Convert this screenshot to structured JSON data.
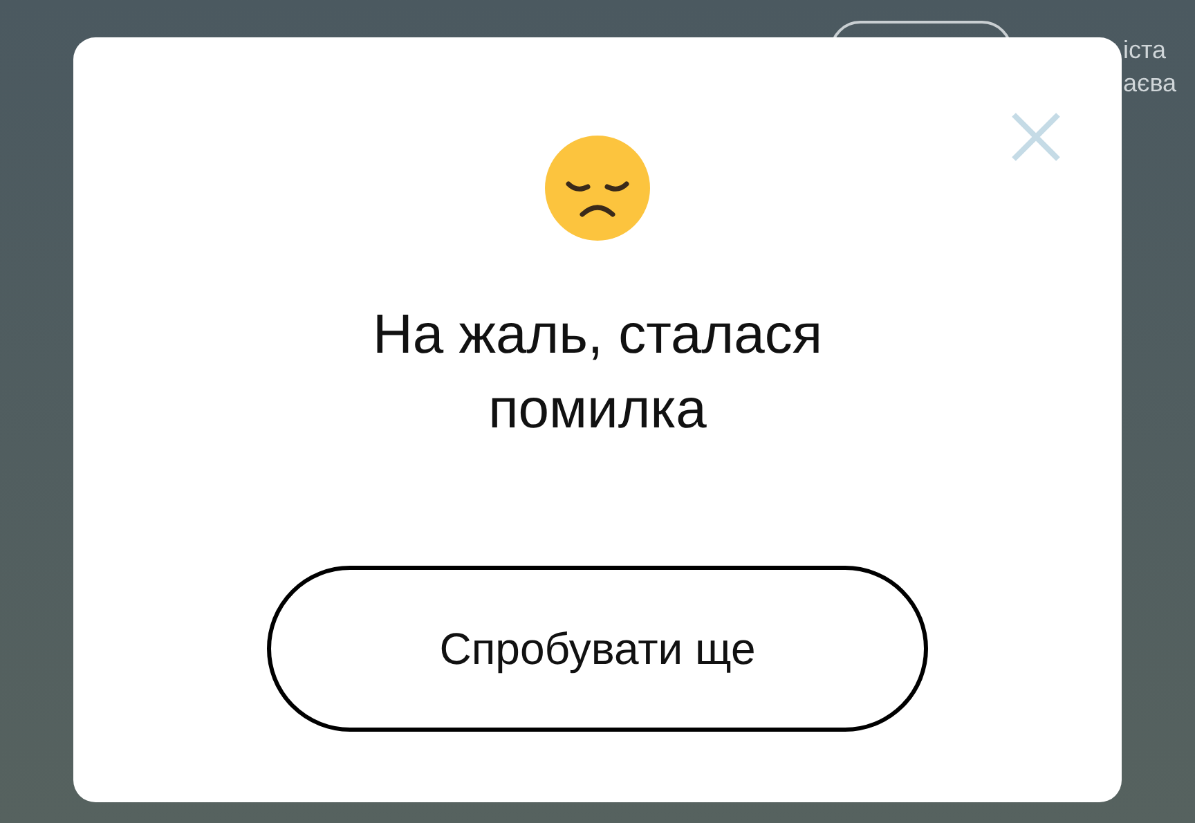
{
  "background": {
    "header_lines": [
      "іста",
      "аєва"
    ]
  },
  "dialog": {
    "title": "На жаль, сталася помилка",
    "button": "Спробувати ще"
  }
}
